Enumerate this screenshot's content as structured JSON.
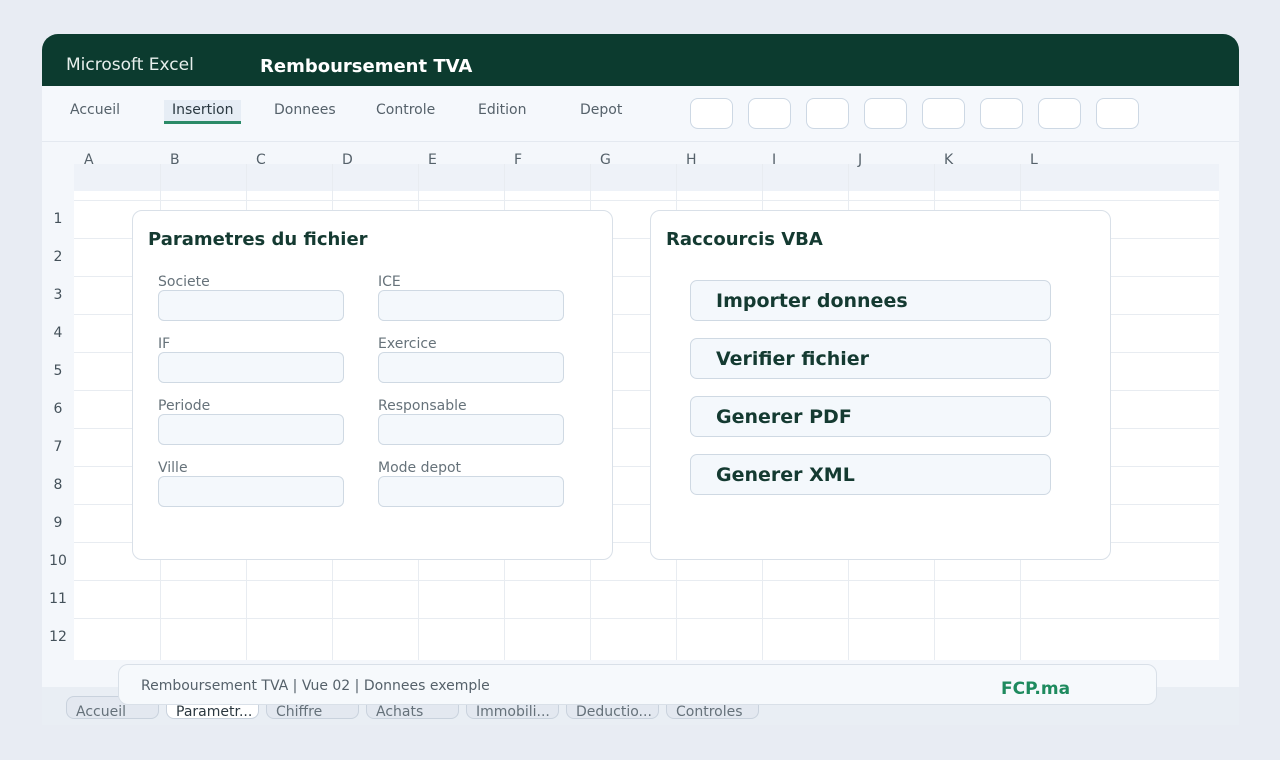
{
  "titlebar": {
    "app_name": "Microsoft Excel",
    "doc_title": "Remboursement TVA"
  },
  "ribbon": {
    "tabs": [
      {
        "label": "Accueil"
      },
      {
        "label": "Insertion",
        "active": true
      },
      {
        "label": "Donnees"
      },
      {
        "label": "Controle"
      },
      {
        "label": "Edition"
      },
      {
        "label": "Depot"
      }
    ]
  },
  "sheet": {
    "columns": [
      "A",
      "B",
      "C",
      "D",
      "E",
      "F",
      "G",
      "H",
      "I",
      "J",
      "K",
      "L"
    ],
    "rows": [
      "1",
      "2",
      "3",
      "4",
      "5",
      "6",
      "7",
      "8",
      "9",
      "10",
      "11",
      "12"
    ]
  },
  "params_panel": {
    "title": "Parametres du fichier",
    "fields": [
      {
        "label": "Societe",
        "value": ""
      },
      {
        "label": "ICE",
        "value": ""
      },
      {
        "label": "IF",
        "value": ""
      },
      {
        "label": "Exercice",
        "value": ""
      },
      {
        "label": "Periode",
        "value": ""
      },
      {
        "label": "Responsable",
        "value": ""
      },
      {
        "label": "Ville",
        "value": ""
      },
      {
        "label": "Mode depot",
        "value": ""
      }
    ]
  },
  "vba_panel": {
    "title": "Raccourcis VBA",
    "buttons": [
      {
        "label": "Importer donnees"
      },
      {
        "label": "Verifier fichier"
      },
      {
        "label": "Generer PDF"
      },
      {
        "label": "Generer XML"
      }
    ]
  },
  "status": {
    "text": "Remboursement TVA | Vue 02 | Donnees exemple",
    "brand": "FCP.ma"
  },
  "sheet_tabs": [
    {
      "label": "Accueil"
    },
    {
      "label": "Parametr...",
      "active": true
    },
    {
      "label": "Chiffre"
    },
    {
      "label": "Achats"
    },
    {
      "label": "Immobili..."
    },
    {
      "label": "Deductio..."
    },
    {
      "label": "Controles"
    }
  ],
  "colors": {
    "titlebar": "#0c3b2f",
    "accent": "#2a8a67",
    "brand": "#1e8a5e"
  }
}
